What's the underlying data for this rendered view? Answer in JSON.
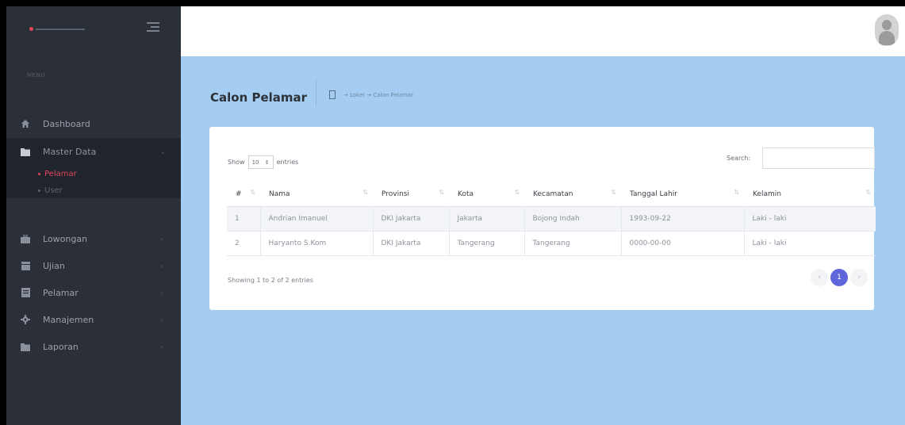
{
  "sidebar": {
    "menu_label": "MENU",
    "items": [
      {
        "label": "Dashboard",
        "icon": "home-icon"
      },
      {
        "label": "Master Data",
        "icon": "folder-icon",
        "chevron": "⌄"
      },
      {
        "label": "Lowongan",
        "icon": "briefcase-icon",
        "chevron": "›"
      },
      {
        "label": "Ujian",
        "icon": "clipboard-icon",
        "chevron": "›"
      },
      {
        "label": "Pelamar",
        "icon": "document-icon",
        "chevron": "›"
      },
      {
        "label": "Manajemen",
        "icon": "gear-icon",
        "chevron": "›"
      },
      {
        "label": "Laporan",
        "icon": "folder-icon",
        "chevron": "›"
      }
    ],
    "sub_items": [
      {
        "label": "Pelamar",
        "active": true
      },
      {
        "label": "User",
        "active": false
      }
    ]
  },
  "header": {
    "page_title": "Calon Pelamar",
    "breadcrumb": "→ Loker → Calon Pelamar"
  },
  "controls": {
    "show_label": "Show",
    "entries_value": "10",
    "entries_label": "entries",
    "search_label": "Search:",
    "search_value": ""
  },
  "table": {
    "columns": [
      "#",
      "Nama",
      "Provinsi",
      "Kota",
      "Kecamatan",
      "Tanggal Lahir",
      "Kelamin"
    ],
    "rows": [
      [
        "1",
        "Andrian Imanuel",
        "DKI Jakarta",
        "Jakarta",
        "Bojong Indah",
        "1993-09-22",
        "Laki - laki"
      ],
      [
        "2",
        "Haryanto S.Kom",
        "DKI Jakarta",
        "Tangerang",
        "Tangerang",
        "0000-00-00",
        "Laki - laki"
      ]
    ]
  },
  "footer": {
    "info": "Showing 1 to 2 of 2 entries",
    "pagination": {
      "prev": "‹",
      "current": "1",
      "next": "›"
    }
  },
  "colors": {
    "sidebar_bg": "#2b2f38",
    "content_bg": "#a4cdf1",
    "accent_active": "#e3455a",
    "pagination_active": "#5f66d9"
  }
}
